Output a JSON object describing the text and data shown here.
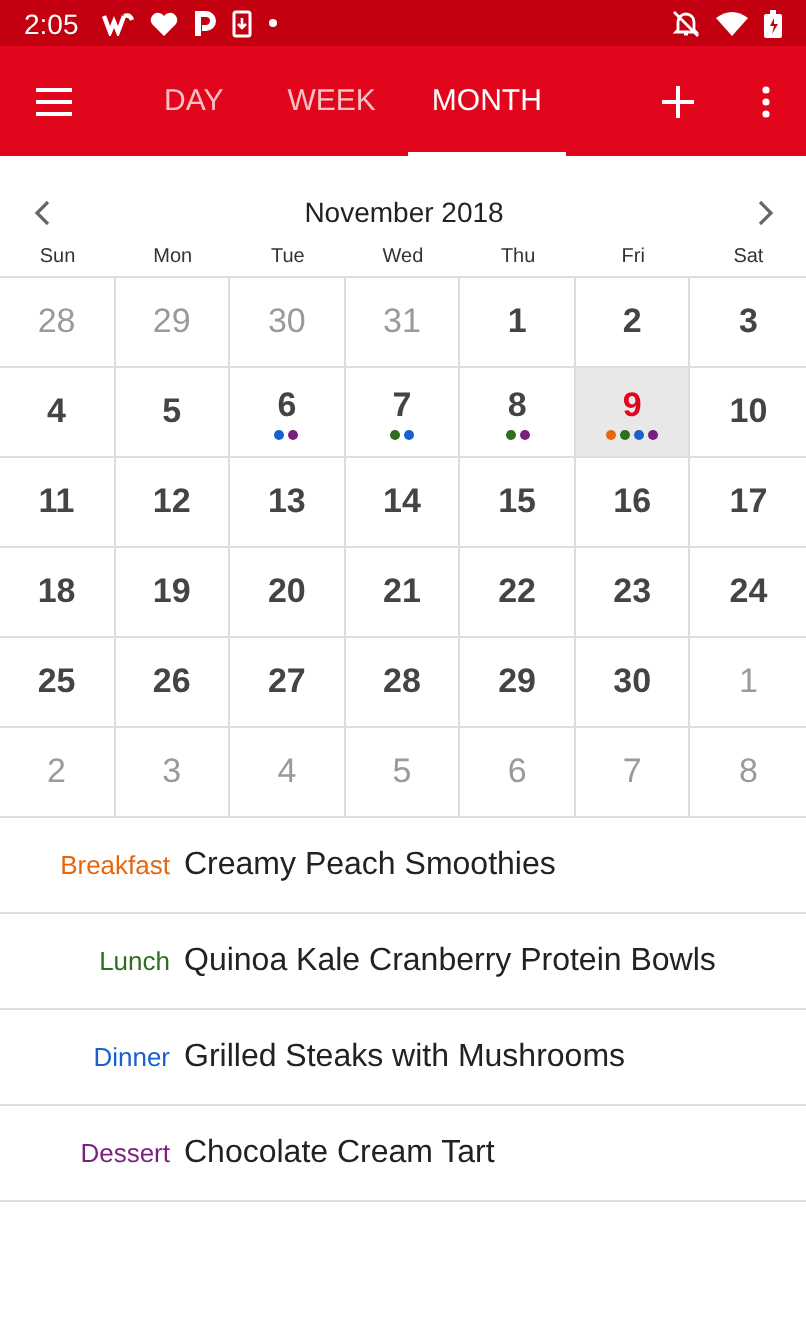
{
  "status_bar": {
    "time": "2:05"
  },
  "tabs": [
    {
      "label": "DAY",
      "selected": false
    },
    {
      "label": "WEEK",
      "selected": false
    },
    {
      "label": "MONTH",
      "selected": true
    }
  ],
  "calendar": {
    "title": "November 2018",
    "weekdays": [
      "Sun",
      "Mon",
      "Tue",
      "Wed",
      "Thu",
      "Fri",
      "Sat"
    ],
    "days": [
      {
        "day": "28",
        "in_month": false,
        "selected": false
      },
      {
        "day": "29",
        "in_month": false,
        "selected": false
      },
      {
        "day": "30",
        "in_month": false,
        "selected": false
      },
      {
        "day": "31",
        "in_month": false,
        "selected": false
      },
      {
        "day": "1",
        "in_month": true,
        "selected": false
      },
      {
        "day": "2",
        "in_month": true,
        "selected": false
      },
      {
        "day": "3",
        "in_month": true,
        "selected": false
      },
      {
        "day": "4",
        "in_month": true,
        "selected": false
      },
      {
        "day": "5",
        "in_month": true,
        "selected": false
      },
      {
        "day": "6",
        "in_month": true,
        "selected": false,
        "dots": [
          {
            "color": "#1a5fd0"
          },
          {
            "color": "#7b1f7e"
          }
        ]
      },
      {
        "day": "7",
        "in_month": true,
        "selected": false,
        "dots": [
          {
            "color": "#2e6e1e"
          },
          {
            "color": "#1a5fd0"
          }
        ]
      },
      {
        "day": "8",
        "in_month": true,
        "selected": false,
        "dots": [
          {
            "color": "#2e6e1e"
          },
          {
            "color": "#7b1f7e"
          }
        ]
      },
      {
        "day": "9",
        "in_month": true,
        "selected": true,
        "dots": [
          {
            "color": "#e8650a"
          },
          {
            "color": "#2e6e1e"
          },
          {
            "color": "#1a5fd0"
          },
          {
            "color": "#7b1f7e"
          }
        ]
      },
      {
        "day": "10",
        "in_month": true,
        "selected": false
      },
      {
        "day": "11",
        "in_month": true,
        "selected": false
      },
      {
        "day": "12",
        "in_month": true,
        "selected": false
      },
      {
        "day": "13",
        "in_month": true,
        "selected": false
      },
      {
        "day": "14",
        "in_month": true,
        "selected": false
      },
      {
        "day": "15",
        "in_month": true,
        "selected": false
      },
      {
        "day": "16",
        "in_month": true,
        "selected": false
      },
      {
        "day": "17",
        "in_month": true,
        "selected": false
      },
      {
        "day": "18",
        "in_month": true,
        "selected": false
      },
      {
        "day": "19",
        "in_month": true,
        "selected": false
      },
      {
        "day": "20",
        "in_month": true,
        "selected": false
      },
      {
        "day": "21",
        "in_month": true,
        "selected": false
      },
      {
        "day": "22",
        "in_month": true,
        "selected": false
      },
      {
        "day": "23",
        "in_month": true,
        "selected": false
      },
      {
        "day": "24",
        "in_month": true,
        "selected": false
      },
      {
        "day": "25",
        "in_month": true,
        "selected": false
      },
      {
        "day": "26",
        "in_month": true,
        "selected": false
      },
      {
        "day": "27",
        "in_month": true,
        "selected": false
      },
      {
        "day": "28",
        "in_month": true,
        "selected": false
      },
      {
        "day": "29",
        "in_month": true,
        "selected": false
      },
      {
        "day": "30",
        "in_month": true,
        "selected": false
      },
      {
        "day": "1",
        "in_month": false,
        "selected": false
      },
      {
        "day": "2",
        "in_month": false,
        "selected": false
      },
      {
        "day": "3",
        "in_month": false,
        "selected": false
      },
      {
        "day": "4",
        "in_month": false,
        "selected": false
      },
      {
        "day": "5",
        "in_month": false,
        "selected": false
      },
      {
        "day": "6",
        "in_month": false,
        "selected": false
      },
      {
        "day": "7",
        "in_month": false,
        "selected": false
      },
      {
        "day": "8",
        "in_month": false,
        "selected": false
      }
    ]
  },
  "meals": [
    {
      "label": "Breakfast",
      "title": "Creamy Peach Smoothies",
      "color": "#e8650a"
    },
    {
      "label": "Lunch",
      "title": "Quinoa Kale Cranberry Protein Bowls",
      "color": "#2e6e1e"
    },
    {
      "label": "Dinner",
      "title": "Grilled Steaks with Mushrooms",
      "color": "#1a5fd0"
    },
    {
      "label": "Dessert",
      "title": "Chocolate Cream Tart",
      "color": "#7b1f7e"
    }
  ]
}
